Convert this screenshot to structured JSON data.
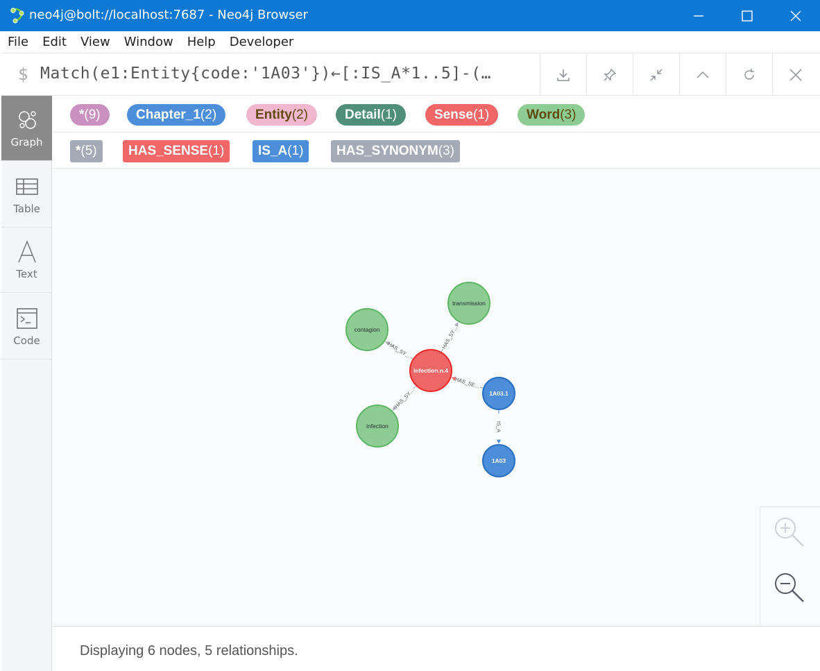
{
  "window": {
    "title": "neo4j@bolt://localhost:7687 - Neo4j Browser"
  },
  "menu": [
    "File",
    "Edit",
    "View",
    "Window",
    "Help",
    "Developer"
  ],
  "editor": {
    "prompt": "$",
    "query": "Match(e1:Entity{code:'1A03'})←[:IS_A*1..5]-(…"
  },
  "toolbar": [
    "download-icon",
    "pin-icon",
    "collapse-icon",
    "chevron-up-icon",
    "refresh-icon",
    "close-icon"
  ],
  "sidebar": [
    {
      "label": "Graph",
      "icon": "graph-icon",
      "active": true
    },
    {
      "label": "Table",
      "icon": "table-icon",
      "active": false
    },
    {
      "label": "Text",
      "icon": "text-icon",
      "active": false
    },
    {
      "label": "Code",
      "icon": "code-icon",
      "active": false
    }
  ],
  "node_labels": [
    {
      "name": "*",
      "count": "(9)",
      "bg": "#c990c0",
      "fg": "#ffffff"
    },
    {
      "name": "Chapter_1",
      "count": "(2)",
      "bg": "#4c8eda",
      "fg": "#ffffff"
    },
    {
      "name": "Entity",
      "count": "(2)",
      "bg": "#f0b7cf",
      "fg": "#604a0e"
    },
    {
      "name": "Detail",
      "count": "(1)",
      "bg": "#57c7b7",
      "fg": "#ffffff"
    },
    {
      "name": "Sense",
      "count": "(1)",
      "bg": "#f16667",
      "fg": "#ffffff"
    },
    {
      "name": "Word",
      "count": "(3)",
      "bg": "#8dcc93",
      "fg": "#604a0e"
    }
  ],
  "rel_types": [
    {
      "name": "*",
      "count": "(5)",
      "bg": "#a5abb6"
    },
    {
      "name": "HAS_SENSE",
      "count": "(1)",
      "bg": "#f16667"
    },
    {
      "name": "IS_A",
      "count": "(1)",
      "bg": "#4c8eda"
    },
    {
      "name": "HAS_SYNONYM",
      "count": "(3)",
      "bg": "#a5abb6"
    }
  ],
  "graph": {
    "nodes": [
      {
        "id": "sense",
        "label": "infection.n.4",
        "type": "Sense"
      },
      {
        "id": "contagion",
        "label": "contagion",
        "type": "Word"
      },
      {
        "id": "transmission",
        "label": "transmission",
        "type": "Word"
      },
      {
        "id": "infection",
        "label": "infection",
        "type": "Word"
      },
      {
        "id": "c1",
        "label": "1A03.1",
        "type": "Chapter_1"
      },
      {
        "id": "c0",
        "label": "1A03",
        "type": "Chapter_1"
      }
    ],
    "relationships": [
      {
        "from": "sense",
        "to": "contagion",
        "label": "HAS_SY…"
      },
      {
        "from": "sense",
        "to": "transmission",
        "label": "HAS_SY…"
      },
      {
        "from": "sense",
        "to": "infection",
        "label": "HAS_SY…"
      },
      {
        "from": "c1",
        "to": "sense",
        "label": "HAS_SE…"
      },
      {
        "from": "c1",
        "to": "c0",
        "label": "IS_A"
      }
    ],
    "colors": {
      "Sense": {
        "fill": "#f16667",
        "stroke": "#eb2728",
        "text": "#ffffff"
      },
      "Word": {
        "fill": "#8dcc93",
        "stroke": "#5db665",
        "text": "#2a2c34"
      },
      "Chapter_1": {
        "fill": "#4c8eda",
        "stroke": "#2870c2",
        "text": "#ffffff"
      },
      "rel": "#a5abb6",
      "rel_text": "#555555",
      "is_a": "#4c8eda"
    }
  },
  "zoom": {
    "in": "zoom-in-icon",
    "out": "zoom-out-icon"
  },
  "status": "Displaying 6 nodes, 5 relationships."
}
